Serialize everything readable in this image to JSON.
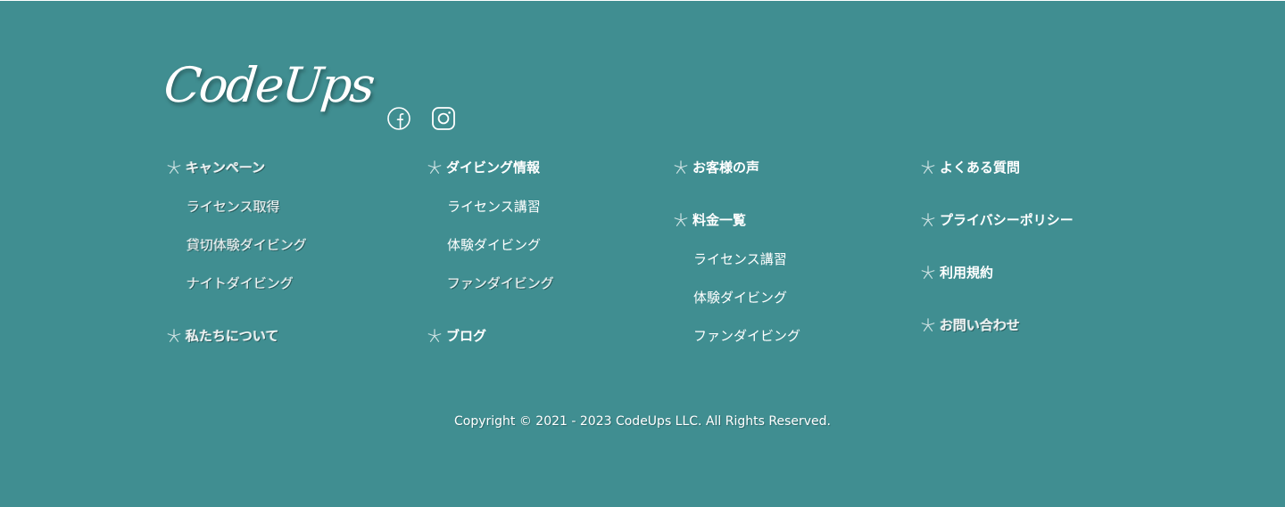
{
  "brand": {
    "logo_text": "CodeUps",
    "background_color": "#408e91",
    "text_color": "#ffffff"
  },
  "social": [
    {
      "icon": "facebook-icon"
    },
    {
      "icon": "instagram-icon"
    }
  ],
  "nav": {
    "col1": {
      "campaign": "キャンペーン",
      "license": "ライセンス取得",
      "charter": "貸切体験ダイビング",
      "night": "ナイトダイビング",
      "about": "私たちについて"
    },
    "col2": {
      "diving_info": "ダイビング情報",
      "license_course": "ライセンス講習",
      "trial": "体験ダイビング",
      "fun": "ファンダイビング",
      "blog": "ブログ"
    },
    "col3": {
      "voice": "お客様の声",
      "price": "料金一覧",
      "license_course": "ライセンス講習",
      "trial": "体験ダイビング",
      "fun": "ファンダイビング"
    },
    "col4": {
      "faq": "よくある質問",
      "privacy": "プライバシーポリシー",
      "terms": "利用規約",
      "contact": "お問い合わせ"
    }
  },
  "copyright": "Copyright © 2021 - 2023 CodeUps LLC. All Rights Reserved."
}
